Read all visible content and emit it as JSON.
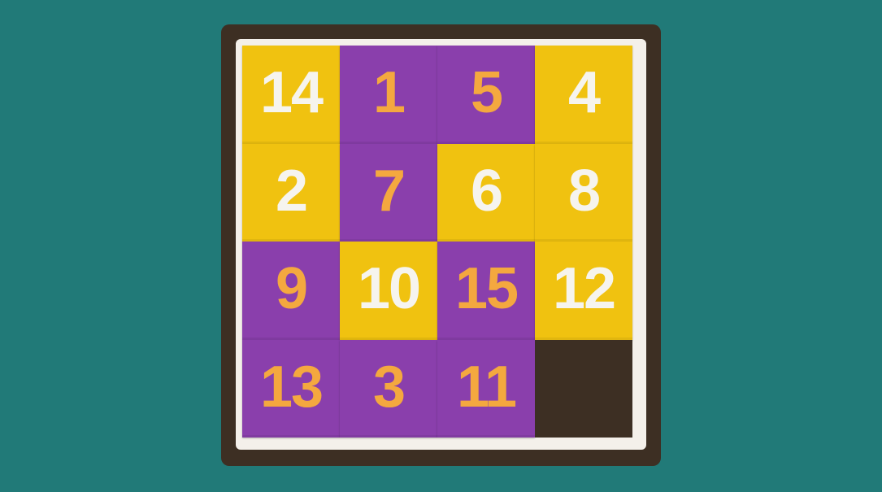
{
  "puzzle": {
    "colors": {
      "background": "#217a78",
      "frame": "#3d2f23",
      "inner_border": "#f4f0ea",
      "yellow_tile": "#f0c210",
      "yellow_text": "#f6f4ee",
      "purple_tile": "#8a3fac",
      "purple_text": "#f4a83f"
    },
    "tiles": [
      {
        "label": "14",
        "color": "yellow"
      },
      {
        "label": "1",
        "color": "purple"
      },
      {
        "label": "5",
        "color": "purple"
      },
      {
        "label": "4",
        "color": "yellow"
      },
      {
        "label": "2",
        "color": "yellow"
      },
      {
        "label": "7",
        "color": "purple"
      },
      {
        "label": "6",
        "color": "yellow"
      },
      {
        "label": "8",
        "color": "yellow"
      },
      {
        "label": "9",
        "color": "purple"
      },
      {
        "label": "10",
        "color": "yellow"
      },
      {
        "label": "15",
        "color": "purple"
      },
      {
        "label": "12",
        "color": "yellow"
      },
      {
        "label": "13",
        "color": "purple"
      },
      {
        "label": "3",
        "color": "purple"
      },
      {
        "label": "11",
        "color": "purple"
      },
      {
        "label": "",
        "color": "empty"
      }
    ]
  }
}
